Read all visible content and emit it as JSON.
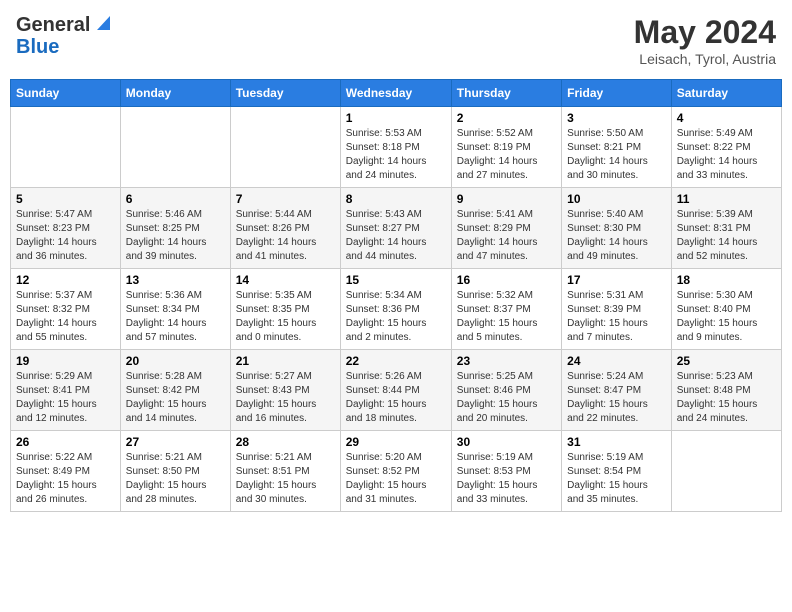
{
  "logo": {
    "general": "General",
    "blue": "Blue"
  },
  "title": "May 2024",
  "location": "Leisach, Tyrol, Austria",
  "days_of_week": [
    "Sunday",
    "Monday",
    "Tuesday",
    "Wednesday",
    "Thursday",
    "Friday",
    "Saturday"
  ],
  "weeks": [
    [
      {
        "day": "",
        "info": ""
      },
      {
        "day": "",
        "info": ""
      },
      {
        "day": "",
        "info": ""
      },
      {
        "day": "1",
        "info": "Sunrise: 5:53 AM\nSunset: 8:18 PM\nDaylight: 14 hours and 24 minutes."
      },
      {
        "day": "2",
        "info": "Sunrise: 5:52 AM\nSunset: 8:19 PM\nDaylight: 14 hours and 27 minutes."
      },
      {
        "day": "3",
        "info": "Sunrise: 5:50 AM\nSunset: 8:21 PM\nDaylight: 14 hours and 30 minutes."
      },
      {
        "day": "4",
        "info": "Sunrise: 5:49 AM\nSunset: 8:22 PM\nDaylight: 14 hours and 33 minutes."
      }
    ],
    [
      {
        "day": "5",
        "info": "Sunrise: 5:47 AM\nSunset: 8:23 PM\nDaylight: 14 hours and 36 minutes."
      },
      {
        "day": "6",
        "info": "Sunrise: 5:46 AM\nSunset: 8:25 PM\nDaylight: 14 hours and 39 minutes."
      },
      {
        "day": "7",
        "info": "Sunrise: 5:44 AM\nSunset: 8:26 PM\nDaylight: 14 hours and 41 minutes."
      },
      {
        "day": "8",
        "info": "Sunrise: 5:43 AM\nSunset: 8:27 PM\nDaylight: 14 hours and 44 minutes."
      },
      {
        "day": "9",
        "info": "Sunrise: 5:41 AM\nSunset: 8:29 PM\nDaylight: 14 hours and 47 minutes."
      },
      {
        "day": "10",
        "info": "Sunrise: 5:40 AM\nSunset: 8:30 PM\nDaylight: 14 hours and 49 minutes."
      },
      {
        "day": "11",
        "info": "Sunrise: 5:39 AM\nSunset: 8:31 PM\nDaylight: 14 hours and 52 minutes."
      }
    ],
    [
      {
        "day": "12",
        "info": "Sunrise: 5:37 AM\nSunset: 8:32 PM\nDaylight: 14 hours and 55 minutes."
      },
      {
        "day": "13",
        "info": "Sunrise: 5:36 AM\nSunset: 8:34 PM\nDaylight: 14 hours and 57 minutes."
      },
      {
        "day": "14",
        "info": "Sunrise: 5:35 AM\nSunset: 8:35 PM\nDaylight: 15 hours and 0 minutes."
      },
      {
        "day": "15",
        "info": "Sunrise: 5:34 AM\nSunset: 8:36 PM\nDaylight: 15 hours and 2 minutes."
      },
      {
        "day": "16",
        "info": "Sunrise: 5:32 AM\nSunset: 8:37 PM\nDaylight: 15 hours and 5 minutes."
      },
      {
        "day": "17",
        "info": "Sunrise: 5:31 AM\nSunset: 8:39 PM\nDaylight: 15 hours and 7 minutes."
      },
      {
        "day": "18",
        "info": "Sunrise: 5:30 AM\nSunset: 8:40 PM\nDaylight: 15 hours and 9 minutes."
      }
    ],
    [
      {
        "day": "19",
        "info": "Sunrise: 5:29 AM\nSunset: 8:41 PM\nDaylight: 15 hours and 12 minutes."
      },
      {
        "day": "20",
        "info": "Sunrise: 5:28 AM\nSunset: 8:42 PM\nDaylight: 15 hours and 14 minutes."
      },
      {
        "day": "21",
        "info": "Sunrise: 5:27 AM\nSunset: 8:43 PM\nDaylight: 15 hours and 16 minutes."
      },
      {
        "day": "22",
        "info": "Sunrise: 5:26 AM\nSunset: 8:44 PM\nDaylight: 15 hours and 18 minutes."
      },
      {
        "day": "23",
        "info": "Sunrise: 5:25 AM\nSunset: 8:46 PM\nDaylight: 15 hours and 20 minutes."
      },
      {
        "day": "24",
        "info": "Sunrise: 5:24 AM\nSunset: 8:47 PM\nDaylight: 15 hours and 22 minutes."
      },
      {
        "day": "25",
        "info": "Sunrise: 5:23 AM\nSunset: 8:48 PM\nDaylight: 15 hours and 24 minutes."
      }
    ],
    [
      {
        "day": "26",
        "info": "Sunrise: 5:22 AM\nSunset: 8:49 PM\nDaylight: 15 hours and 26 minutes."
      },
      {
        "day": "27",
        "info": "Sunrise: 5:21 AM\nSunset: 8:50 PM\nDaylight: 15 hours and 28 minutes."
      },
      {
        "day": "28",
        "info": "Sunrise: 5:21 AM\nSunset: 8:51 PM\nDaylight: 15 hours and 30 minutes."
      },
      {
        "day": "29",
        "info": "Sunrise: 5:20 AM\nSunset: 8:52 PM\nDaylight: 15 hours and 31 minutes."
      },
      {
        "day": "30",
        "info": "Sunrise: 5:19 AM\nSunset: 8:53 PM\nDaylight: 15 hours and 33 minutes."
      },
      {
        "day": "31",
        "info": "Sunrise: 5:19 AM\nSunset: 8:54 PM\nDaylight: 15 hours and 35 minutes."
      },
      {
        "day": "",
        "info": ""
      }
    ]
  ]
}
